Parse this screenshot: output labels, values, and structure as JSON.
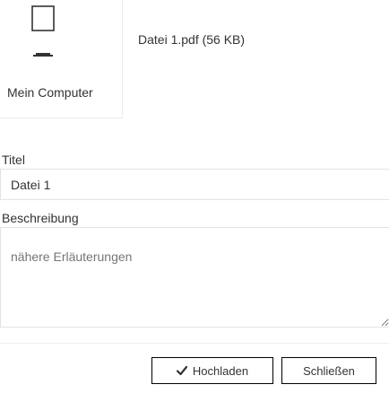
{
  "source": {
    "label": "Mein Computer",
    "icon": "computer-icon"
  },
  "file": {
    "info": "Datei 1.pdf (56 KB)"
  },
  "form": {
    "title_label": "Titel",
    "title_value": "Datei 1",
    "description_label": "Beschreibung",
    "description_placeholder": "nähere Erläuterungen"
  },
  "actions": {
    "upload_label": "Hochladen",
    "upload_icon": "check-icon",
    "close_label": "Schließen"
  },
  "colors": {
    "border": "#e3e3e3",
    "text": "#333333",
    "button_border": "#000000"
  }
}
